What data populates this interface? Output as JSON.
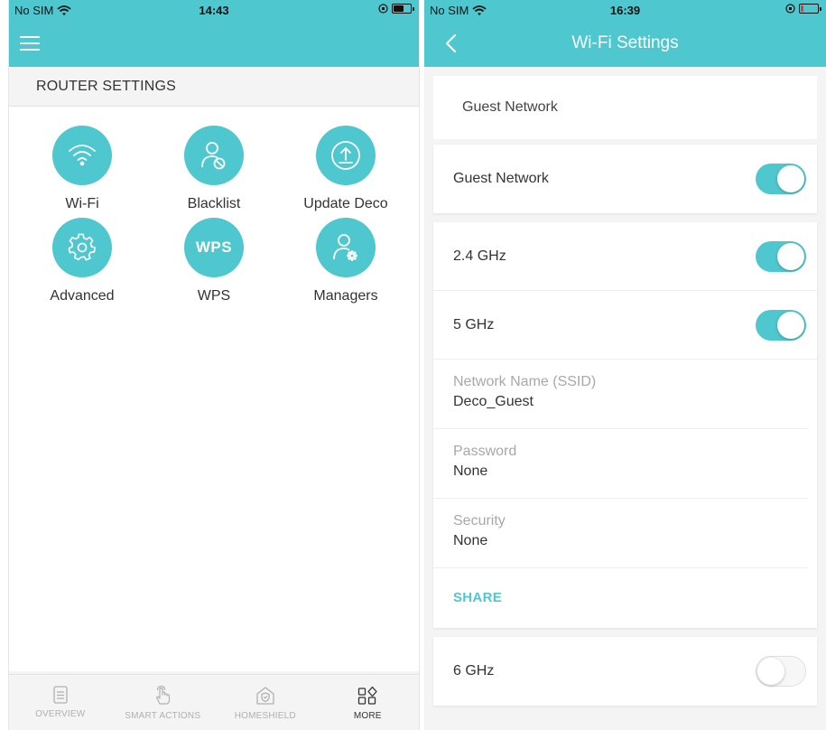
{
  "left": {
    "status": {
      "carrier": "No SIM",
      "time": "14:43"
    },
    "section_title": "ROUTER SETTINGS",
    "tiles": [
      {
        "label": "Wi-Fi",
        "icon": "wifi-icon"
      },
      {
        "label": "Blacklist",
        "icon": "blacklist-user-icon"
      },
      {
        "label": "Update Deco",
        "icon": "upload-icon"
      },
      {
        "label": "Advanced",
        "icon": "gear-icon"
      },
      {
        "label": "WPS",
        "icon": "wps-icon",
        "text": "WPS"
      },
      {
        "label": "Managers",
        "icon": "manager-user-icon"
      }
    ],
    "tabs": [
      {
        "label": "OVERVIEW",
        "icon": "document-icon"
      },
      {
        "label": "SMART ACTIONS",
        "icon": "tap-hand-icon"
      },
      {
        "label": "HOMESHIELD",
        "icon": "home-shield-icon"
      },
      {
        "label": "MORE",
        "icon": "grid-more-icon"
      }
    ],
    "active_tab": "MORE"
  },
  "right": {
    "status": {
      "carrier": "No SIM",
      "time": "16:39"
    },
    "title": "Wi-Fi Settings",
    "section_label": "Guest Network",
    "guest_toggle": {
      "label": "Guest Network",
      "on": true
    },
    "bands": [
      {
        "label": "2.4 GHz",
        "on": true
      },
      {
        "label": "5 GHz",
        "on": true
      }
    ],
    "fields": [
      {
        "label": "Network Name (SSID)",
        "value": "Deco_Guest"
      },
      {
        "label": "Password",
        "value": "None"
      },
      {
        "label": "Security",
        "value": "None"
      }
    ],
    "share_label": "SHARE",
    "band6": {
      "label": "6 GHz",
      "on": false
    }
  },
  "colors": {
    "accent": "#4fc7cf",
    "battery_low": "#e53935"
  }
}
